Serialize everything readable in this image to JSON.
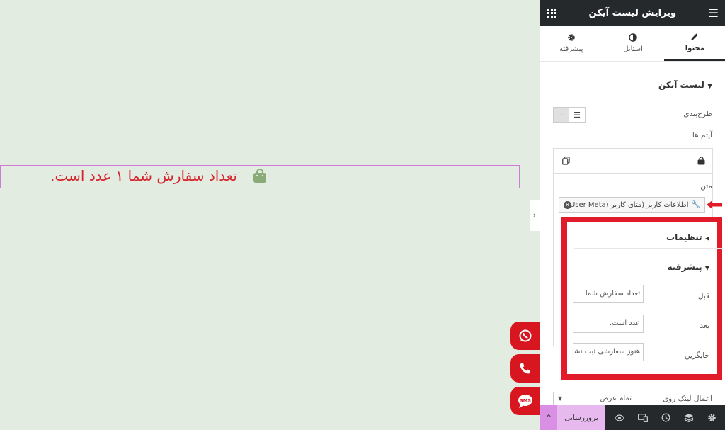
{
  "canvas": {
    "widget_text": "تعداد سفارش شما ۱ عدد است.",
    "text_color": "#d6232c"
  },
  "panel": {
    "title": "ویرایش لیست آیکن",
    "tabs": [
      {
        "label": "محتوا",
        "icon": "pencil-icon",
        "active": true
      },
      {
        "label": "استایل",
        "icon": "half-circle-icon",
        "active": false
      },
      {
        "label": "پیشرفته",
        "icon": "gear-icon",
        "active": false
      }
    ],
    "section_title": "لیست آیکن",
    "layout_label": "طرح‌بندی",
    "items_label": "آیتم ها",
    "text_label": "متن",
    "dynamic_tag": "اطلاعات کاربر (متای کاربر (User Meta...",
    "settings_title": "تنظیمات",
    "advanced_title": "پیشرفته",
    "before_label": "قبل",
    "before_value": "تعداد سفارش شما",
    "after_label": "بعد",
    "after_value": "عدد است.",
    "fallback_label": "جایگزین",
    "fallback_value": "هنوز سفارشی ثبت نشده",
    "link_apply_label": "اعمال لینک روی",
    "link_apply_value": "تمام عرض"
  },
  "bottombar": {
    "update_label": "بروزرسانی"
  },
  "colors": {
    "accent_red": "#e21b2b",
    "dark": "#26292c",
    "pink": "#e7b9ef"
  }
}
